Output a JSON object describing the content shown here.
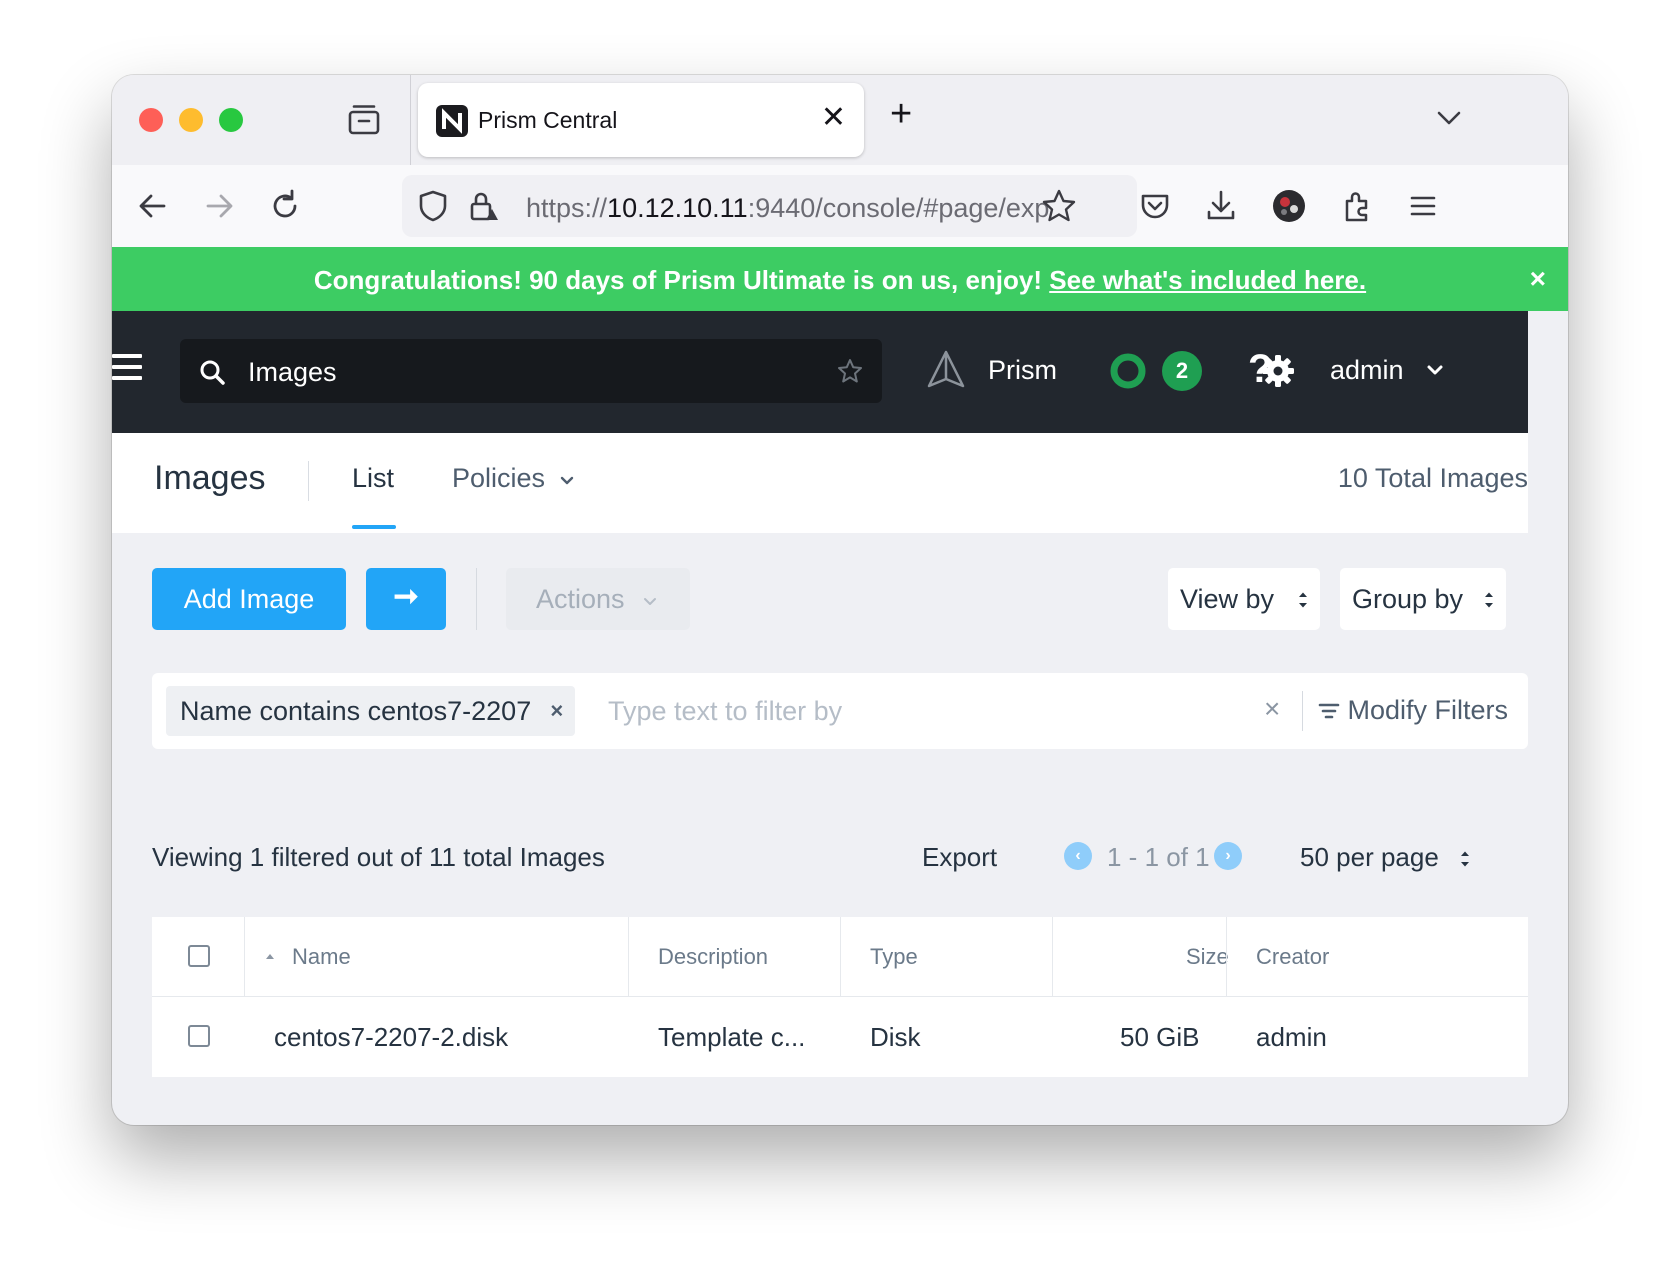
{
  "browser": {
    "tab_title": "Prism Central",
    "url_prefix": "https://",
    "url_host": "10.12.10.11",
    "url_rest": ":9440/console/#page/exp"
  },
  "banner": {
    "text": "Congratulations! 90 days of Prism Ultimate is on us, enjoy!",
    "link": "See what's included here.",
    "close": "×"
  },
  "appbar": {
    "search_value": "Images",
    "prism_label": "Prism",
    "alert_count": "2",
    "help": "?",
    "user": "admin"
  },
  "page": {
    "title": "Images",
    "tabs": {
      "list": "List",
      "policies": "Policies"
    },
    "total": "10 Total Images"
  },
  "toolbar": {
    "add_image": "Add Image",
    "arrow": "➞",
    "actions": "Actions",
    "view_by": "View by",
    "group_by": "Group by"
  },
  "filters": {
    "chip": "Name contains centos7-2207",
    "chip_close": "×",
    "placeholder": "Type text to filter by",
    "clear": "×",
    "modify": "Modify Filters"
  },
  "list_meta": {
    "viewing": "Viewing 1 filtered out of 11 total Images",
    "export": "Export",
    "prev": "‹",
    "next": "›",
    "range": "1 - 1 of 1",
    "per_page": "50 per page"
  },
  "table": {
    "columns": [
      "Name",
      "Description",
      "Type",
      "Size",
      "Creator"
    ],
    "rows": [
      {
        "name": "centos7-2207-2.disk",
        "description": "Template c...",
        "type": "Disk",
        "size": "50 GiB",
        "creator": "admin"
      }
    ]
  },
  "colors": {
    "accent": "#22a5f7",
    "banner": "#3dcc63",
    "appbar": "#22272e",
    "badge": "#1f9f52"
  },
  "icons": [
    "tab-overview-icon",
    "nutanix-favicon-icon",
    "close-icon",
    "plus-icon",
    "chevron-down-icon",
    "back-icon",
    "forward-icon",
    "reload-icon",
    "shield-icon",
    "lock-icon",
    "star-icon",
    "pocket-icon",
    "download-icon",
    "avatar-icon",
    "extensions-icon",
    "menu-icon",
    "search-icon",
    "prism-icon",
    "status-ring-icon",
    "gear-icon",
    "filter-icon",
    "sort-asc-icon",
    "updown-icon"
  ]
}
